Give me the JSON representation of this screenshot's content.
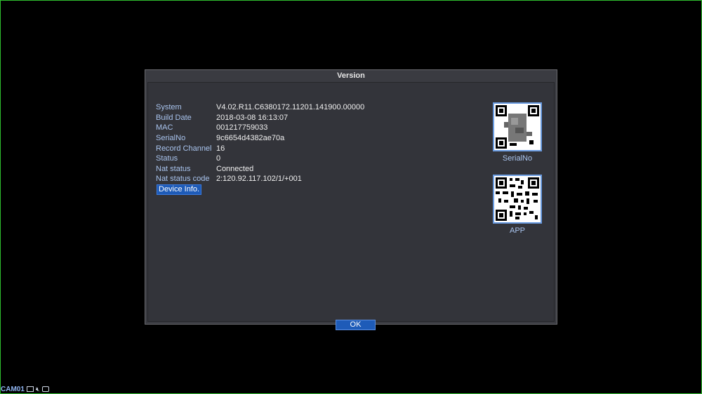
{
  "dialog": {
    "title": "Version",
    "info": [
      {
        "label": "System",
        "value": "V4.02.R11.C6380172.11201.141900.00000"
      },
      {
        "label": "Build Date",
        "value": "2018-03-08 16:13:07"
      },
      {
        "label": "MAC",
        "value": "001217759033"
      },
      {
        "label": "SerialNo",
        "value": "9c6654d4382ae70a"
      },
      {
        "label": "Record Channel",
        "value": "16"
      },
      {
        "label": "Status",
        "value": "0"
      },
      {
        "label": "Nat status",
        "value": "Connected"
      },
      {
        "label": "Nat status code",
        "value": "2:120.92.117.102/1/+001"
      }
    ],
    "device_info_label": "Device Info.",
    "qr_serial_caption": "SerialNo",
    "qr_app_caption": "APP",
    "ok_label": "OK"
  },
  "status_bar": {
    "camera": "CAM01",
    "icons": [
      "record-icon",
      "mute-speaker-icon",
      "motion-icon"
    ]
  },
  "colors": {
    "background": "#000000",
    "dialog_bg": "#33343a",
    "label_color": "#a9c4ee",
    "accent": "#1e5bb8"
  }
}
